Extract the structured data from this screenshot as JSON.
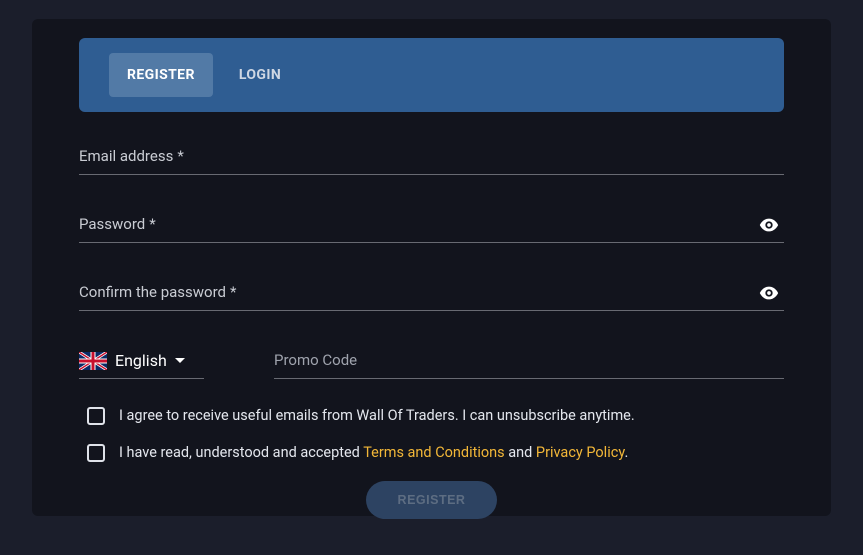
{
  "tabs": {
    "register": "REGISTER",
    "login": "LOGIN"
  },
  "fields": {
    "email_label": "Email address",
    "password_label": "Password",
    "confirm_label": "Confirm the password",
    "required_mark": "*",
    "promo_label": "Promo Code"
  },
  "language": {
    "name": "English"
  },
  "checks": {
    "emails": "I agree to receive useful emails from Wall Of Traders. I can unsubscribe anytime.",
    "terms_prefix": "I have read, understood and accepted ",
    "terms_link": "Terms and Conditions",
    "terms_mid": " and ",
    "privacy_link": "Privacy Policy",
    "terms_suffix": "."
  },
  "submit_label": "REGISTER"
}
